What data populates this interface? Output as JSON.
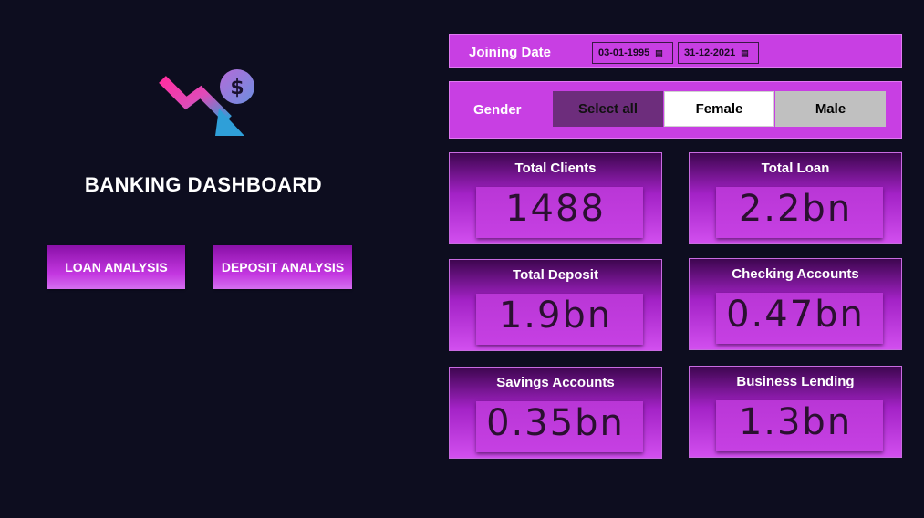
{
  "brand": {
    "title": "BANKING DASHBOARD",
    "logo_icon": "falling-arrow-dollar-icon",
    "colors": {
      "background": "#0d0d1f",
      "accent": "#c83fe3",
      "arrow_start": "#ff2fa0",
      "arrow_end": "#2f9fd8"
    }
  },
  "nav": {
    "loan_label": "LOAN ANALYSIS",
    "deposit_label": "DEPOSIT ANALYSIS"
  },
  "filters": {
    "joining_date": {
      "label": "Joining Date",
      "start": "03-01-1995",
      "end": "31-12-2021",
      "icon": "calendar-icon"
    },
    "gender": {
      "label": "Gender",
      "options": [
        "Select all",
        "Female",
        "Male"
      ],
      "selected": "Female"
    }
  },
  "kpis": [
    {
      "label": "Total Clients",
      "value": "1488"
    },
    {
      "label": "Total Loan",
      "value": "2.2bn"
    },
    {
      "label": "Total Deposit",
      "value": "1.9bn"
    },
    {
      "label": "Checking Accounts",
      "value": "0.47bn"
    },
    {
      "label": "Savings Accounts",
      "value": "0.35bn"
    },
    {
      "label": "Business Lending",
      "value": "1.3bn"
    }
  ]
}
